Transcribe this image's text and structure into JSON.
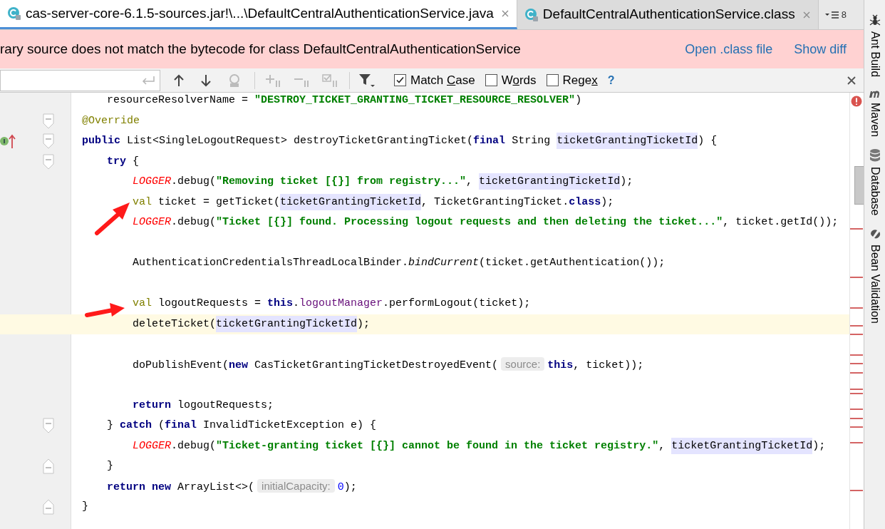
{
  "tabs": [
    {
      "label": "cas-server-core-6.1.5-sources.jar!\\...\\DefaultCentralAuthenticationService.java",
      "selected": true
    },
    {
      "label": "DefaultCentralAuthenticationService.class",
      "selected": false
    }
  ],
  "tab_overflow": {
    "count": "8"
  },
  "banner": {
    "message": "rary source does not match the bytecode for class DefaultCentralAuthenticationService",
    "links": [
      "Open .class file",
      "Show diff"
    ]
  },
  "find_bar": {
    "options": [
      {
        "label_parts": [
          "Match ",
          "C",
          "ase"
        ],
        "checked": true
      },
      {
        "label_parts": [
          "W",
          "o",
          "rds"
        ],
        "checked": false
      },
      {
        "label_parts": [
          "Rege",
          "x"
        ],
        "checked": false
      }
    ],
    "help": "?"
  },
  "code_lines": [
    {
      "kind": "continuation",
      "tokens": [
        {
          "kind": "plain",
          "text": "resourceResolverName = "
        },
        {
          "kind": "string",
          "text": "\"DESTROY_TICKET_GRANTING_TICKET_RESOURCE_RESOLVER\""
        },
        {
          "kind": "plain",
          "text": ")"
        }
      ]
    },
    {
      "kind": "code",
      "fold_start": true,
      "tokens": [
        {
          "kind": "annotation",
          "text": "@Override"
        }
      ]
    },
    {
      "kind": "code",
      "fold_start": true,
      "implements": true,
      "tokens": [
        {
          "kind": "keyword",
          "text": "public"
        },
        {
          "kind": "plain",
          "text": " List<SingleLogoutRequest> destroyTicketGrantingTicket("
        },
        {
          "kind": "keyword",
          "text": "final"
        },
        {
          "kind": "plain",
          "text": " String "
        },
        {
          "kind": "highlight",
          "text": "ticketGrantingTicketId"
        },
        {
          "kind": "plain",
          "text": ") {"
        }
      ],
      "children": [
        {
          "kind": "code",
          "fold_start": true,
          "tokens": [
            {
              "kind": "keyword",
              "text": "try"
            },
            {
              "kind": "plain",
              "text": " {"
            }
          ],
          "children": [
            {
              "kind": "code",
              "tokens": [
                {
                  "kind": "logger",
                  "text": "LOGGER"
                },
                {
                  "kind": "plain",
                  "text": ".debug("
                },
                {
                  "kind": "string",
                  "text": "\"Removing ticket [{}] from registry...\""
                },
                {
                  "kind": "plain",
                  "text": ", "
                },
                {
                  "kind": "highlight",
                  "text": "ticketGrantingTicketId"
                },
                {
                  "kind": "plain",
                  "text": ");"
                }
              ]
            },
            {
              "kind": "code",
              "tokens": [
                {
                  "kind": "soft_keyword",
                  "text": "val"
                },
                {
                  "kind": "plain",
                  "text": " ticket = getTicket("
                },
                {
                  "kind": "highlight",
                  "text": "ticketGrantingTicketId"
                },
                {
                  "kind": "plain",
                  "text": ", TicketGrantingTicket."
                },
                {
                  "kind": "keyword",
                  "text": "class"
                },
                {
                  "kind": "plain",
                  "text": ");"
                }
              ]
            },
            {
              "kind": "code",
              "tokens": [
                {
                  "kind": "logger",
                  "text": "LOGGER"
                },
                {
                  "kind": "plain",
                  "text": ".debug("
                },
                {
                  "kind": "string",
                  "text": "\"Ticket [{}] found. Processing logout requests and then deleting the ticket...\""
                },
                {
                  "kind": "plain",
                  "text": ", ticket.getId());"
                }
              ]
            },
            {
              "kind": "blank"
            },
            {
              "kind": "code",
              "tokens": [
                {
                  "kind": "plain",
                  "text": "AuthenticationCredentialsThreadLocalBinder."
                },
                {
                  "kind": "static",
                  "text": "bindCurrent"
                },
                {
                  "kind": "plain",
                  "text": "(ticket.getAuthentication());"
                }
              ]
            },
            {
              "kind": "blank"
            },
            {
              "kind": "code",
              "tokens": [
                {
                  "kind": "soft_keyword",
                  "text": "val"
                },
                {
                  "kind": "plain",
                  "text": " logoutRequests = "
                },
                {
                  "kind": "keyword",
                  "text": "this"
                },
                {
                  "kind": "plain",
                  "text": "."
                },
                {
                  "kind": "field",
                  "text": "logoutManager"
                },
                {
                  "kind": "plain",
                  "text": ".performLogout(ticket);"
                }
              ]
            },
            {
              "kind": "code",
              "current": true,
              "tokens": [
                {
                  "kind": "plain",
                  "text": "deleteTicket("
                },
                {
                  "kind": "highlight",
                  "text": "ticketGrantingTicketId"
                },
                {
                  "kind": "plain",
                  "text": ");"
                }
              ]
            },
            {
              "kind": "blank"
            },
            {
              "kind": "code",
              "tokens": [
                {
                  "kind": "plain",
                  "text": "doPublishEvent("
                },
                {
                  "kind": "keyword",
                  "text": "new"
                },
                {
                  "kind": "plain",
                  "text": " CasTicketGrantingTicketDestroyedEvent("
                },
                {
                  "kind": "hint",
                  "text": "source:"
                },
                {
                  "kind": "keyword",
                  "text": "this"
                },
                {
                  "kind": "plain",
                  "text": ", ticket));"
                }
              ]
            },
            {
              "kind": "blank"
            },
            {
              "kind": "code",
              "tokens": [
                {
                  "kind": "keyword",
                  "text": "return"
                },
                {
                  "kind": "plain",
                  "text": " logoutRequests;"
                }
              ]
            }
          ]
        },
        {
          "kind": "code",
          "fold_start": true,
          "tokens": [
            {
              "kind": "plain",
              "text": "} "
            },
            {
              "kind": "keyword",
              "text": "catch"
            },
            {
              "kind": "plain",
              "text": " ("
            },
            {
              "kind": "keyword",
              "text": "final"
            },
            {
              "kind": "plain",
              "text": " InvalidTicketException e) {"
            }
          ],
          "children": [
            {
              "kind": "code",
              "tokens": [
                {
                  "kind": "logger",
                  "text": "LOGGER"
                },
                {
                  "kind": "plain",
                  "text": ".debug("
                },
                {
                  "kind": "string",
                  "text": "\"Ticket-granting ticket [{}] cannot be found in the ticket registry.\""
                },
                {
                  "kind": "plain",
                  "text": ", "
                },
                {
                  "kind": "highlight",
                  "text": "ticketGrantingTicketId"
                },
                {
                  "kind": "plain",
                  "text": ");"
                }
              ]
            }
          ]
        },
        {
          "kind": "code",
          "fold_end": true,
          "tokens": [
            {
              "kind": "plain",
              "text": "}"
            }
          ]
        },
        {
          "kind": "code",
          "tokens": [
            {
              "kind": "keyword",
              "text": "return new"
            },
            {
              "kind": "plain",
              "text": " ArrayList<>("
            },
            {
              "kind": "hint",
              "text": "initialCapacity:"
            },
            {
              "kind": "number",
              "text": "0"
            },
            {
              "kind": "plain",
              "text": ");"
            }
          ]
        }
      ]
    },
    {
      "kind": "code",
      "fold_end": true,
      "tokens": [
        {
          "kind": "plain",
          "text": "}"
        }
      ]
    }
  ],
  "tool_windows": [
    {
      "label": "Ant Build",
      "kind": "ant"
    },
    {
      "label": "Maven",
      "kind": "maven"
    },
    {
      "label": "Database",
      "kind": "database"
    },
    {
      "label": "Bean Validation",
      "kind": "bean"
    }
  ]
}
